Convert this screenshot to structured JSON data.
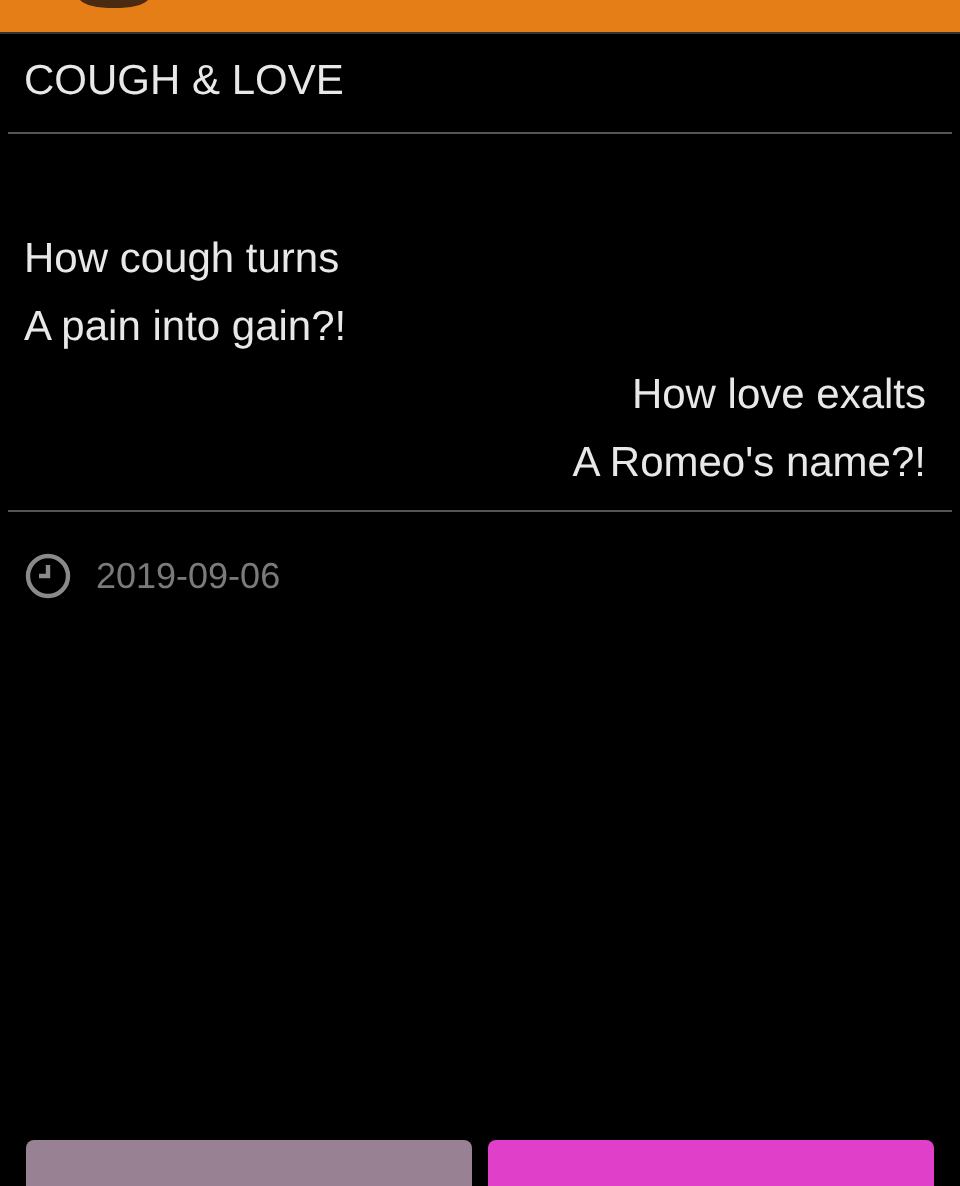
{
  "title": "COUGH & LOVE",
  "poem_lines": [
    {
      "text": "How cough turns",
      "kind": "left"
    },
    {
      "text": "A pain into gain?!",
      "kind": "left"
    },
    {
      "text": "How love exalts",
      "kind": "right"
    },
    {
      "text": "A Romeo's name?!",
      "kind": "right"
    }
  ],
  "date": "2019-09-06",
  "buttons": [
    {
      "kind": "secondary"
    },
    {
      "kind": "primary"
    }
  ]
}
